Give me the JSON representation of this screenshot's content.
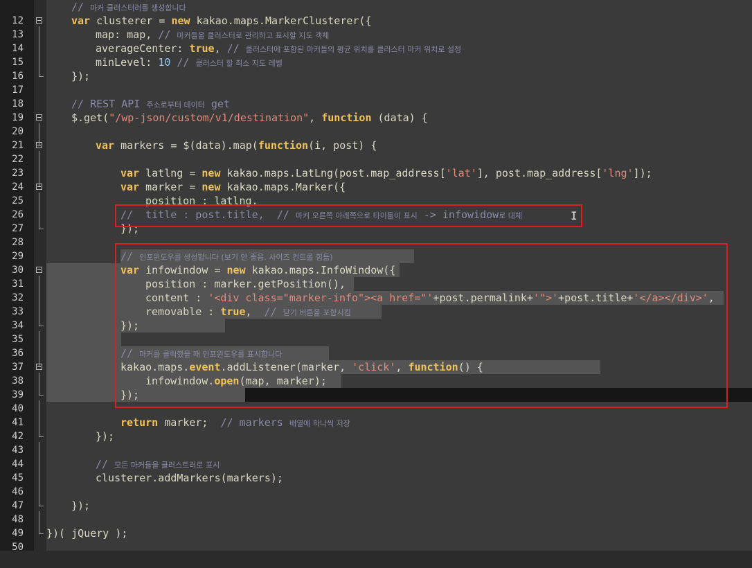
{
  "editor": {
    "lines": [
      {
        "n": "12",
        "ln": "12"
      },
      {
        "n": "13",
        "ln": "13"
      },
      {
        "n": "14",
        "ln": "14"
      },
      {
        "n": "15",
        "ln": "15"
      },
      {
        "n": "16",
        "ln": "16"
      },
      {
        "n": "17",
        "ln": "17"
      },
      {
        "n": "18",
        "ln": "18"
      },
      {
        "n": "19",
        "ln": "19"
      },
      {
        "n": "20",
        "ln": "20"
      },
      {
        "n": "21",
        "ln": "21"
      },
      {
        "n": "22",
        "ln": "22"
      },
      {
        "n": "23",
        "ln": "23"
      },
      {
        "n": "24",
        "ln": "24"
      },
      {
        "n": "25",
        "ln": "25"
      },
      {
        "n": "26",
        "ln": "26"
      },
      {
        "n": "27",
        "ln": "27"
      },
      {
        "n": "28",
        "ln": "28"
      },
      {
        "n": "29",
        "ln": "29"
      },
      {
        "n": "30",
        "ln": "30"
      },
      {
        "n": "31",
        "ln": "31"
      },
      {
        "n": "32",
        "ln": "32"
      },
      {
        "n": "33",
        "ln": "33"
      },
      {
        "n": "34",
        "ln": "34"
      },
      {
        "n": "35",
        "ln": "35"
      },
      {
        "n": "36",
        "ln": "36"
      },
      {
        "n": "37",
        "ln": "37"
      },
      {
        "n": "38",
        "ln": "38"
      },
      {
        "n": "39",
        "ln": "39"
      },
      {
        "n": "40",
        "ln": "40"
      },
      {
        "n": "41",
        "ln": "41"
      },
      {
        "n": "42",
        "ln": "42"
      },
      {
        "n": "43",
        "ln": "43"
      },
      {
        "n": "44",
        "ln": "44"
      },
      {
        "n": "45",
        "ln": "45"
      },
      {
        "n": "46",
        "ln": "46"
      },
      {
        "n": "47",
        "ln": "47"
      },
      {
        "n": "48",
        "ln": "48"
      },
      {
        "n": "49",
        "ln": "49"
      },
      {
        "n": "50",
        "ln": "50"
      }
    ],
    "code": {
      "l12_cm": "// ",
      "l12_cmko": "마커 클러스터러를 생성합니다",
      "l13_kw": "var",
      "l13_a": " clusterer = ",
      "l13_kw2": "new",
      "l13_b": " kakao.maps.MarkerClusterer({",
      "l14_a": "map: map, ",
      "l14_cm": "// ",
      "l14_cmko": "마커들을 클러스터로 관리하고 표시할 지도 객체",
      "l15_a": "averageCenter: ",
      "l15_kw": "true",
      "l15_b": ", ",
      "l15_cm": "// ",
      "l15_cmko": "클러스터에 포함된 마커들의 평균 위치를 클러스터 마커 위치로 설정",
      "l16_a": "minLevel: ",
      "l16_num": "10",
      "l16_b": " ",
      "l16_cm": "// ",
      "l16_cmko": "클러스터 할 최소 지도 레벨",
      "l17_a": "});",
      "l19_cm": "// REST API ",
      "l19_cmko": "주소로부터 데이터",
      "l19_cm2": " get",
      "l20_a": "$.get(",
      "l20_str": "\"/wp-json/custom/v1/destination\"",
      "l20_b": ", ",
      "l20_kw": "function",
      "l20_c": " (data) {",
      "l22_kw": "var",
      "l22_a": " markers = $(data).map(",
      "l22_kw2": "function",
      "l22_b": "(i, post) {",
      "l24_kw": "var",
      "l24_a": " latlng = ",
      "l24_kw2": "new",
      "l24_b": " kakao.maps.LatLng(post.map_address[",
      "l24_str": "'lat'",
      "l24_c": "], post.map_address[",
      "l24_str2": "'lng'",
      "l24_d": "]);",
      "l25_kw": "var",
      "l25_a": " marker = ",
      "l25_kw2": "new",
      "l25_b": " kakao.maps.Marker({",
      "l26_a": "position : latlng,",
      "l27_cm": "//  title : post.title,  // ",
      "l27_cmko": "마커 오른쪽 아래쪽으로 타이틀이 표시",
      "l27_cm2": " -> infowidow",
      "l27_cmko2": "로 대체",
      "l28_a": "});",
      "l30_cm": "// ",
      "l30_cmko": "인포윈도우를 생성합니다 (보기 안 좋음. 사이즈 컨트롤 힘듦)",
      "l31_kw": "var",
      "l31_a": " infowindow = ",
      "l31_kw2": "new",
      "l31_b": " kakao.maps.InfoWindow({",
      "l32_a": "position : marker.getPosition(),",
      "l33_a": "content : ",
      "l33_str": "'<div class=\"marker-info\"><a href=\"'",
      "l33_b": "+post.permalink+",
      "l33_str2": "'\">'",
      "l33_c": "+post.title+",
      "l33_str3": "'</a></div>'",
      "l33_d": ",",
      "l34_a": "removable : ",
      "l34_kw": "true",
      "l34_b": ",  ",
      "l34_cm": "// ",
      "l34_cmko": "닫기 버튼을 포함시킴",
      "l35_a": "});",
      "l37_cm": "// ",
      "l37_cmko": "마커를 클릭했을 때 인포윈도우를 표시합니다",
      "l38_a": "kakao.maps.",
      "l38_kw": "event",
      "l38_b": ".addListener(marker, ",
      "l38_str": "'click'",
      "l38_c": ", ",
      "l38_kw2": "function",
      "l38_d": "() {",
      "l39_a": "infowindow.",
      "l39_kw": "open",
      "l39_b": "(map, marker);",
      "l40_a": "});",
      "l42_kw": "return",
      "l42_a": " marker;  ",
      "l42_cm": "// markers ",
      "l42_cmko": "배열에 하나씩 저장",
      "l43_a": "});",
      "l45_cm": "// ",
      "l45_cmko": "모든 마커들을 클러스트러로 표시",
      "l46_a": "clusterer.addMarkers(markers);",
      "l48_a": "});",
      "l50_a": "})( jQuery );"
    },
    "colors": {
      "background": "#3a3a3a",
      "gutter": "#1e1e1e",
      "keyword": "#f2c356",
      "comment": "#8a8aa8",
      "string": "#e08b7b",
      "number": "#90c8f0",
      "highlight_box": "#d9201f",
      "selection": "#545454"
    },
    "cursor_icon": "text-ibeam-cursor-icon"
  }
}
